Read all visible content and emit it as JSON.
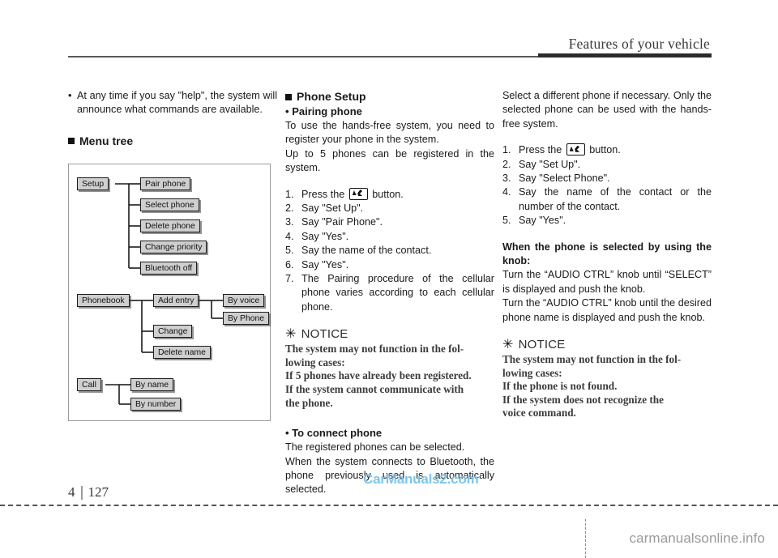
{
  "header": {
    "title": "Features of your vehicle"
  },
  "page_footer": {
    "chapter": "4",
    "folio": "127",
    "watermark_bottom": "carmanualsonline.info",
    "watermark_body": "CarManuals2.com"
  },
  "left_column": {
    "bullet_note": {
      "bullet": "•",
      "text": "At any time if you say \"help\", the system will announce what commands are available."
    },
    "menu_tree_heading": "Menu tree"
  },
  "menu_tree": {
    "groups": [
      {
        "root": "Setup",
        "children": [
          {
            "label": "Pair phone"
          },
          {
            "label": "Select phone"
          },
          {
            "label": "Delete phone"
          },
          {
            "label": "Change priority"
          },
          {
            "label": "Bluetooth off"
          }
        ]
      },
      {
        "root": "Phonebook",
        "children": [
          {
            "label": "Add entry",
            "grandchildren": [
              "By voice",
              "By Phone"
            ]
          },
          {
            "label": "Change"
          },
          {
            "label": "Delete name"
          }
        ]
      },
      {
        "root": "Call",
        "children": [
          {
            "label": "By name"
          },
          {
            "label": "By number"
          }
        ]
      }
    ],
    "nodes": {
      "setup": "Setup",
      "pair_phone": "Pair phone",
      "select_phone": "Select phone",
      "delete_phone": "Delete phone",
      "change_priority": "Change priority",
      "bluetooth_off": "Bluetooth off",
      "phonebook": "Phonebook",
      "add_entry": "Add entry",
      "by_voice": "By voice",
      "by_phone": "By Phone",
      "change": "Change",
      "delete_name": "Delete name",
      "call": "Call",
      "by_name": "By name",
      "by_number": "By number"
    }
  },
  "middle_column": {
    "heading": "Phone Setup",
    "subheading": "Pairing phone",
    "subheading_dot": "•",
    "intro_1": "To use the hands-free system, you need to register your phone in the system.",
    "intro_2": "Up to 5 phones can be registered in the system.",
    "steps": [
      {
        "num": "1.",
        "pre": "Press the",
        "post": "button."
      },
      {
        "num": "2.",
        "text": "Say \"Set Up\"."
      },
      {
        "num": "3.",
        "text": "Say \"Pair Phone\"."
      },
      {
        "num": "4.",
        "text": "Say \"Yes\"."
      },
      {
        "num": "5.",
        "text": "Say the name of the contact."
      },
      {
        "num": "6.",
        "text": "Say \"Yes\"."
      },
      {
        "num": "7.",
        "text": "The Pairing procedure of the cellular phone varies according to each cellular phone."
      }
    ],
    "notice": {
      "star": "✳",
      "title": "NOTICE",
      "lines": [
        "The system may not function in the fol-",
        "lowing cases:",
        "If 5 phones have already been registered.",
        "If the system cannot communicate with",
        "the phone."
      ]
    },
    "connect_subheading": "To connect phone",
    "connect_dot": "•",
    "connect_body_1": "The registered phones can be selected.",
    "connect_body_2": "When the system connects to Bluetooth, the phone previously used is automatically selected."
  },
  "right_column": {
    "intro": "Select a different phone if necessary. Only the selected phone can be used with the hands-free system.",
    "steps": [
      {
        "num": "1.",
        "pre": "Press the",
        "post": "button."
      },
      {
        "num": "2.",
        "text": "Say \"Set Up\"."
      },
      {
        "num": "3.",
        "text": "Say \"Select Phone\"."
      },
      {
        "num": "4.",
        "text": "Say the name of the contact or the number of the contact."
      },
      {
        "num": "5.",
        "text": "Say \"Yes\"."
      }
    ],
    "knob_heading": "When the phone is selected by using the knob:",
    "knob_body_1": "Turn the “AUDIO CTRL” knob until “SELECT” is displayed and push the knob.",
    "knob_body_2": "Turn the “AUDIO CTRL” knob until the desired phone name is displayed and push the knob.",
    "notice": {
      "star": "✳",
      "title": "NOTICE",
      "lines": [
        "The system may not function in the fol-",
        "lowing cases:",
        "If the phone is not found.",
        "If the system does not recognize the",
        "voice command."
      ]
    }
  },
  "icons": {
    "talk_button": "talk-button-icon"
  },
  "colors": {
    "text": "#1a1a1a",
    "node_fill": "#cfcfcf",
    "node_border": "#1c1c1c",
    "header_rule": "#2b2b2b",
    "watermark_blue": "#7cc6ea",
    "watermark_gray": "#9a9a9a"
  }
}
